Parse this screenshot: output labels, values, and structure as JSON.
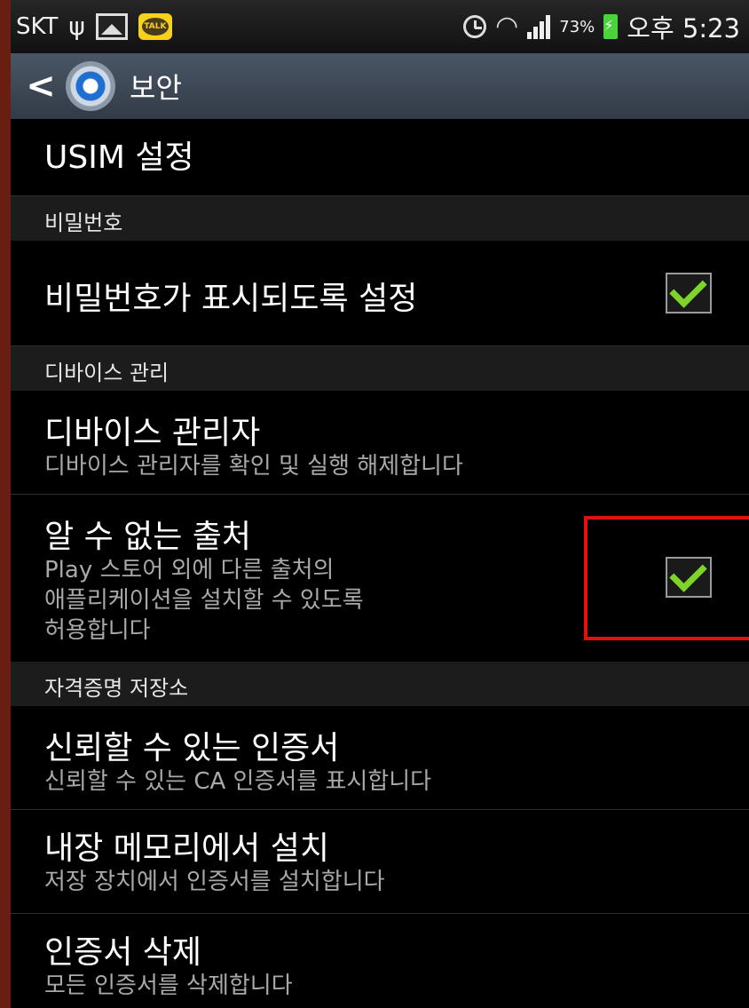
{
  "status_bar": {
    "carrier": "SKT",
    "icons": [
      "usb-icon",
      "gallery-icon",
      "kakaotalk-icon",
      "alarm-icon",
      "wifi-icon",
      "signal-icon",
      "battery-icon"
    ],
    "talk_label": "TALK",
    "battery": "73%",
    "time": "오후 5:23"
  },
  "action_bar": {
    "title": "보안"
  },
  "list": {
    "usim": {
      "title": "USIM 설정"
    },
    "password_header": "비밀번호",
    "show_password": {
      "title": "비밀번호가 표시되도록 설정",
      "checked": true
    },
    "device_header": "디바이스 관리",
    "device_admin": {
      "title": "디바이스 관리자",
      "subtitle": "디바이스 관리자를 확인 및 실행 해제합니다"
    },
    "unknown_sources": {
      "title": "알 수 없는 출처",
      "subtitle_line1": "Play 스토어 외에 다른 출처의",
      "subtitle_line2": "애플리케이션을 설치할 수 있도록",
      "subtitle_line3": "허용합니다",
      "checked": true
    },
    "credential_header": "자격증명 저장소",
    "trusted_certs": {
      "title": "신뢰할 수 있는 인증서",
      "subtitle": "신뢰할 수 있는 CA 인증서를 표시합니다"
    },
    "install_from_storage": {
      "title": "내장 메모리에서 설치",
      "subtitle": "저장 장치에서 인증서를 설치합니다"
    },
    "clear_credentials": {
      "title": "인증서 삭제",
      "subtitle": "모든 인증서를 삭제합니다"
    }
  },
  "colors": {
    "check": "#7fd42a",
    "highlight": "#e41010",
    "header_bg": "#1c1c1c",
    "actionbar": "#3d4754"
  }
}
